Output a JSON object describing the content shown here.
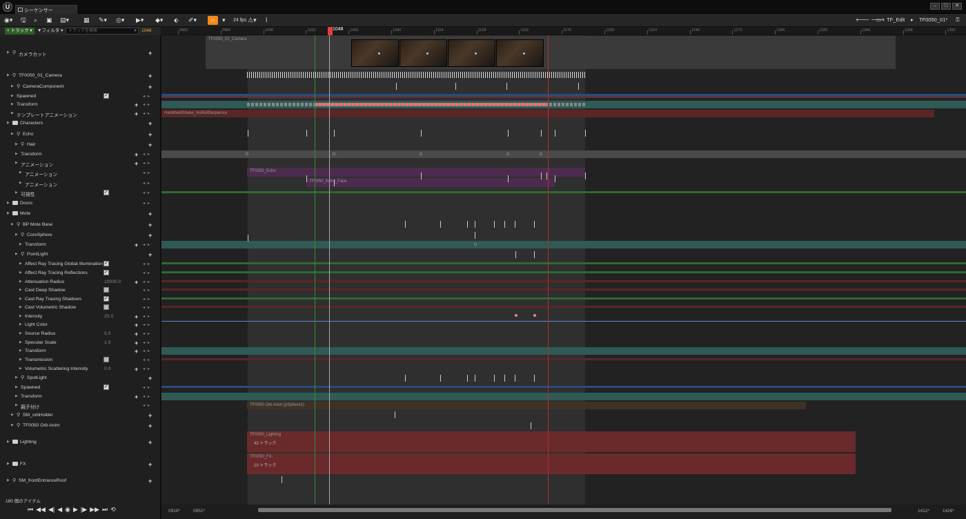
{
  "app": {
    "title": "シーケンサー",
    "logo": "U"
  },
  "window": {
    "buttons": [
      "–",
      "□",
      "✕"
    ]
  },
  "toolbar": {
    "fps": "24 fps",
    "breadcrumb": [
      "TF_Edit",
      "TF0050_01*"
    ],
    "icons": [
      "world-icon",
      "save-icon",
      "search-icon",
      "camera-icon",
      "clapboard-icon",
      "render-icon",
      "wrench-icon",
      "eye-icon",
      "play-icon",
      "key-icon",
      "transform-icon",
      "pen-icon",
      "magnet-icon",
      "warning-icon",
      "curve-icon"
    ]
  },
  "track_panel": {
    "add_track": "+ トラック ▾",
    "filter": "▼フィルタ ▾",
    "search_placeholder": "トラックを検索",
    "current_frame": "1048"
  },
  "tracks": [
    {
      "label": "カメラカット",
      "indent": 0,
      "type": "folderish"
    },
    {
      "label": "TF0050_01_Camera",
      "indent": 0
    },
    {
      "label": "CameraComponent",
      "indent": 1
    },
    {
      "label": "Spawned",
      "indent": 1,
      "check": true
    },
    {
      "label": "Transform",
      "indent": 1
    },
    {
      "label": "テンプレートアニメーション",
      "indent": 1
    },
    {
      "label": "Characters",
      "indent": 0
    },
    {
      "label": "Echo",
      "indent": 1
    },
    {
      "label": "Hair",
      "indent": 2
    },
    {
      "label": "Transform",
      "indent": 2
    },
    {
      "label": "アニメーション",
      "indent": 2
    },
    {
      "label": "アニメーション",
      "indent": 3
    },
    {
      "label": "アニメーション",
      "indent": 3
    },
    {
      "label": "可視性",
      "indent": 2,
      "check": true
    },
    {
      "label": "Doors",
      "indent": 0
    },
    {
      "label": "Mote",
      "indent": 0
    },
    {
      "label": "BP Mote Base",
      "indent": 1
    },
    {
      "label": "CoreSphere",
      "indent": 2
    },
    {
      "label": "Transform",
      "indent": 3
    },
    {
      "label": "PointLight",
      "indent": 2
    },
    {
      "label": "Affect Ray Tracing Global Illumination",
      "indent": 3,
      "check": true
    },
    {
      "label": "Affect Ray Tracing Reflections",
      "indent": 3,
      "check": true
    },
    {
      "label": "Attenuation Radius",
      "indent": 3,
      "value": "10000.0"
    },
    {
      "label": "Cast Deep Shadow",
      "indent": 3,
      "check": false
    },
    {
      "label": "Cast Ray Tracing Shadows",
      "indent": 3,
      "check": true
    },
    {
      "label": "Cast Volumetric Shadow",
      "indent": 3,
      "check": false
    },
    {
      "label": "Intensity",
      "indent": 3,
      "value": "25.0"
    },
    {
      "label": "Light Color",
      "indent": 3
    },
    {
      "label": "Source Radius",
      "indent": 3,
      "value": "5.0"
    },
    {
      "label": "Specular Scale",
      "indent": 3,
      "value": "1.0"
    },
    {
      "label": "Transform",
      "indent": 3
    },
    {
      "label": "Transmission",
      "indent": 3,
      "check": false
    },
    {
      "label": "Volumetric Scattering Intensity",
      "indent": 3,
      "value": "0.0"
    },
    {
      "label": "SpotLight",
      "indent": 2
    },
    {
      "label": "Spawned",
      "indent": 2,
      "check": true
    },
    {
      "label": "Transform",
      "indent": 2
    },
    {
      "label": "親子付け",
      "indent": 2
    },
    {
      "label": "SM_orbHolder",
      "indent": 1
    },
    {
      "label": "TF0050 Orb Anim",
      "indent": 1
    },
    {
      "label": "Lighting",
      "indent": 0
    },
    {
      "label": "FX",
      "indent": 0
    },
    {
      "label": "SM_frontEntranceRoof",
      "indent": 0
    }
  ],
  "item_count": "180 個のアイテム",
  "timeline": {
    "ticks": [
      "0960",
      "0984",
      "1008",
      "1032",
      "1056",
      "1080",
      "1104",
      "1128",
      "1152",
      "1176",
      "1200",
      "1224",
      "1248",
      "1272",
      "1296",
      "1320",
      "1344",
      "1368",
      "1392"
    ],
    "playhead": "1048",
    "start_labels": [
      "0919*",
      "0951*"
    ],
    "end_labels": [
      "1412*",
      "1426*"
    ],
    "sections": {
      "camera": "TF0050_01_Camera",
      "handheld": "HandheldShake_NoRollSequence",
      "echo": "TF0050_Echo",
      "echo_face": "TF0050_Echo_Face",
      "orb": "TF0050 Orb Anim (pSphere1)",
      "lighting": "TF0050_Lighting",
      "lighting_sub": "42 トラック",
      "fx": "TF0050_FX",
      "fx_sub": "10 トラック"
    }
  }
}
